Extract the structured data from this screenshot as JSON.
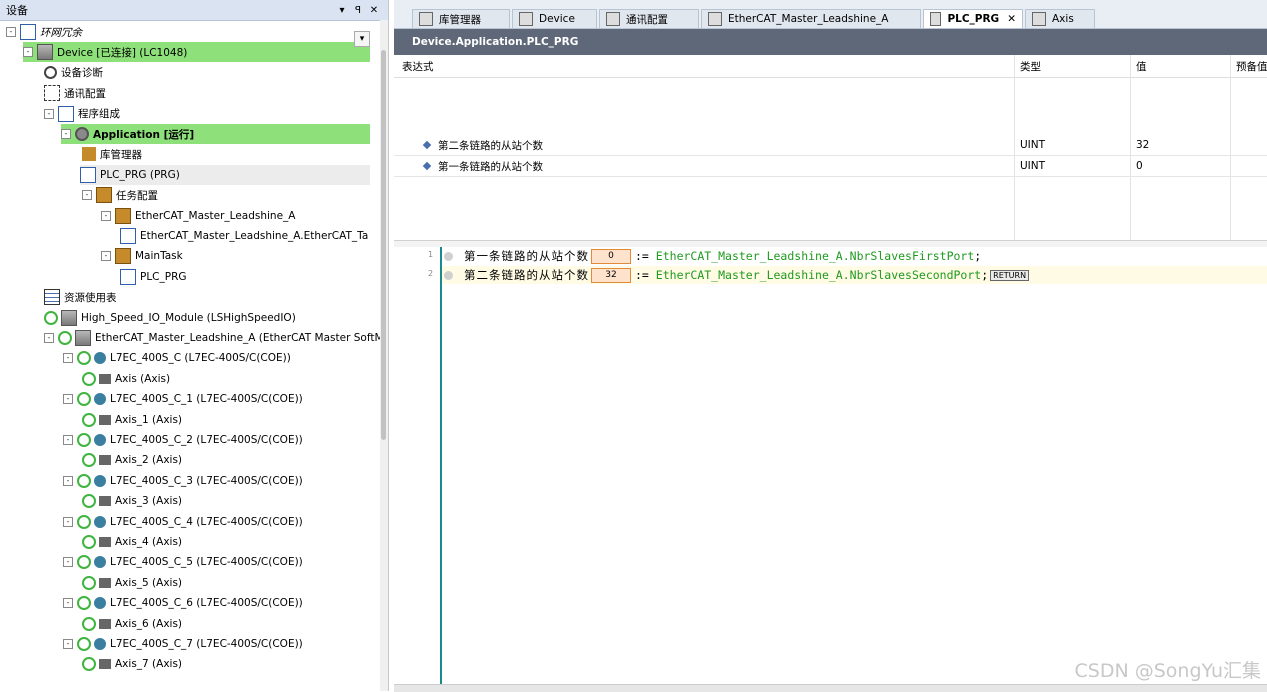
{
  "left_panel": {
    "title": "设备",
    "pin": "▾ ꟼ",
    "close": "✕",
    "tree": [
      {
        "label": "环网冗余",
        "indent": 0,
        "icon": "project-icon",
        "expand": "-"
      },
      {
        "label": "Device [已连接] (LC1048)",
        "indent": 1,
        "icon": "device-icon",
        "expand": "-",
        "hl": "green"
      },
      {
        "label": "设备诊断",
        "indent": 2,
        "icon": "lens-icon"
      },
      {
        "label": "通讯配置",
        "indent": 2,
        "icon": "network-icon"
      },
      {
        "label": "程序组成",
        "indent": 2,
        "icon": "program-icon",
        "expand": "-"
      },
      {
        "label": "Application [运行]",
        "indent": 3,
        "icon": "gear-icon",
        "expand": "-",
        "hl": "green",
        "bold": true
      },
      {
        "label": "库管理器",
        "indent": 4,
        "icon": "library-icon"
      },
      {
        "label": "PLC_PRG (PRG)",
        "indent": 4,
        "icon": "doc-icon",
        "hl": "grey"
      },
      {
        "label": "任务配置",
        "indent": 4,
        "icon": "task-icon",
        "expand": "-"
      },
      {
        "label": "EtherCAT_Master_Leadshine_A",
        "indent": 5,
        "icon": "task-icon",
        "expand": "-"
      },
      {
        "label": "EtherCAT_Master_Leadshine_A.EtherCAT_Ta",
        "indent": 6,
        "icon": "doc-icon"
      },
      {
        "label": "MainTask",
        "indent": 5,
        "icon": "task-icon",
        "expand": "-"
      },
      {
        "label": "PLC_PRG",
        "indent": 6,
        "icon": "doc-icon"
      },
      {
        "label": "资源使用表",
        "indent": 2,
        "icon": "resource-icon"
      },
      {
        "label": "High_Speed_IO_Module (LSHighSpeedIO)",
        "indent": 2,
        "icon": "device-icon"
      },
      {
        "label": "EtherCAT_Master_Leadshine_A (EtherCAT Master SoftMoti",
        "indent": 2,
        "icon": "device-icon",
        "expand": "-"
      },
      {
        "label": "L7EC_400S_C (L7EC-400S/C(COE))",
        "indent": 3,
        "icon": "drive-icon",
        "expand": "-"
      },
      {
        "label": "Axis (Axis)",
        "indent": 4,
        "icon": "axis-icon"
      },
      {
        "label": "L7EC_400S_C_1 (L7EC-400S/C(COE))",
        "indent": 3,
        "icon": "drive-icon",
        "expand": "-"
      },
      {
        "label": "Axis_1 (Axis)",
        "indent": 4,
        "icon": "axis-icon"
      },
      {
        "label": "L7EC_400S_C_2 (L7EC-400S/C(COE))",
        "indent": 3,
        "icon": "drive-icon",
        "expand": "-"
      },
      {
        "label": "Axis_2 (Axis)",
        "indent": 4,
        "icon": "axis-icon"
      },
      {
        "label": "L7EC_400S_C_3 (L7EC-400S/C(COE))",
        "indent": 3,
        "icon": "drive-icon",
        "expand": "-"
      },
      {
        "label": "Axis_3 (Axis)",
        "indent": 4,
        "icon": "axis-icon"
      },
      {
        "label": "L7EC_400S_C_4 (L7EC-400S/C(COE))",
        "indent": 3,
        "icon": "drive-icon",
        "expand": "-"
      },
      {
        "label": "Axis_4 (Axis)",
        "indent": 4,
        "icon": "axis-icon"
      },
      {
        "label": "L7EC_400S_C_5 (L7EC-400S/C(COE))",
        "indent": 3,
        "icon": "drive-icon",
        "expand": "-"
      },
      {
        "label": "Axis_5 (Axis)",
        "indent": 4,
        "icon": "axis-icon"
      },
      {
        "label": "L7EC_400S_C_6 (L7EC-400S/C(COE))",
        "indent": 3,
        "icon": "drive-icon",
        "expand": "-"
      },
      {
        "label": "Axis_6 (Axis)",
        "indent": 4,
        "icon": "axis-icon"
      },
      {
        "label": "L7EC_400S_C_7 (L7EC-400S/C(COE))",
        "indent": 3,
        "icon": "drive-icon",
        "expand": "-"
      },
      {
        "label": "Axis_7 (Axis)",
        "indent": 4,
        "icon": "axis-icon"
      }
    ]
  },
  "tabs": [
    {
      "label": "库管理器",
      "active": false
    },
    {
      "label": "Device",
      "active": false
    },
    {
      "label": "通讯配置",
      "active": false
    },
    {
      "label": "EtherCAT_Master_Leadshine_A",
      "active": false
    },
    {
      "label": "PLC_PRG",
      "active": true,
      "close": "✕"
    },
    {
      "label": "Axis",
      "active": false
    }
  ],
  "path": "Device.Application.PLC_PRG",
  "watch": {
    "headers": {
      "expr": "表达式",
      "type": "类型",
      "value": "值",
      "prepared": "预备值"
    },
    "rows": [
      {
        "expr": "第二条链路的从站个数",
        "type": "UINT",
        "value": "32"
      },
      {
        "expr": "第一条链路的从站个数",
        "type": "UINT",
        "value": "0"
      }
    ]
  },
  "code": {
    "lines": [
      {
        "num": "1",
        "var": "第一条链路的从站个数",
        "val": "0",
        "op": ":=",
        "rhs": "EtherCAT_Master_Leadshine_A.NbrSlavesFirstPort",
        "end": ";"
      },
      {
        "num": "2",
        "var": "第二条链路的从站个数",
        "val": "32",
        "op": ":=",
        "rhs": "EtherCAT_Master_Leadshine_A.NbrSlavesSecondPort",
        "end": ";",
        "ret": "RETURN"
      }
    ]
  },
  "watermark": "CSDN @SongYu汇集"
}
